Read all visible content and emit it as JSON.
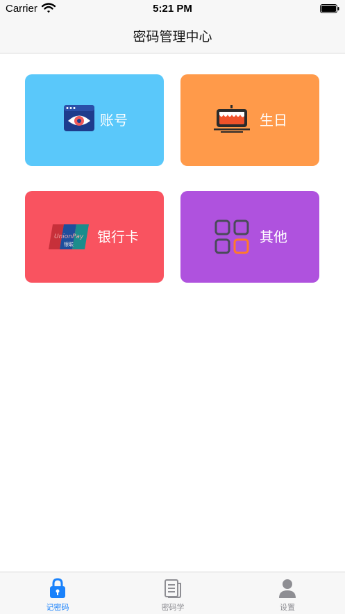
{
  "status_bar": {
    "carrier": "Carrier",
    "time": "5:21 PM"
  },
  "nav": {
    "title": "密码管理中心"
  },
  "cards": [
    {
      "label": "账号",
      "icon": "eye-window-icon",
      "color": "#5AC8FA"
    },
    {
      "label": "生日",
      "icon": "birthday-cake-icon",
      "color": "#FF9A4A"
    },
    {
      "label": "银行卡",
      "icon": "unionpay-card-icon",
      "color": "#F95360"
    },
    {
      "label": "其他",
      "icon": "grid-icon",
      "color": "#AF52DE"
    }
  ],
  "tab_bar": {
    "active_color": "#1A82FB",
    "inactive_color": "#8E8E93",
    "tabs": [
      {
        "label": "记密码",
        "icon": "lock-icon",
        "active": true
      },
      {
        "label": "密码学",
        "icon": "document-icon",
        "active": false
      },
      {
        "label": "设置",
        "icon": "person-icon",
        "active": false
      }
    ]
  }
}
